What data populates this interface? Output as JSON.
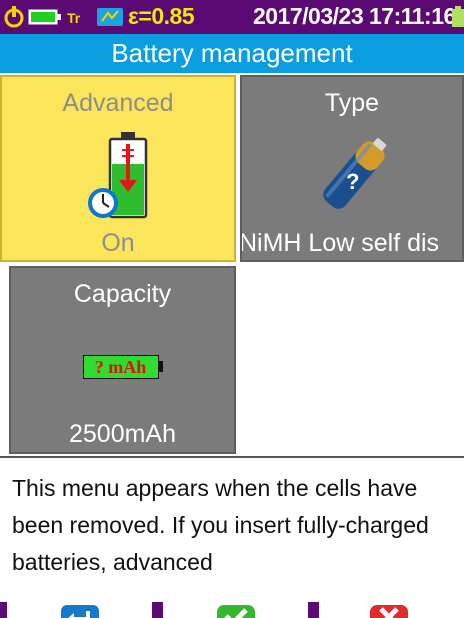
{
  "status_bar": {
    "emissivity_text": "ε=0.85",
    "datetime_text": "2017/03/23 17:11:16",
    "icons": [
      "power-icon",
      "battery-level-icon",
      "trigger-icon",
      "sd-card-icon",
      "battery-small-icon"
    ],
    "colors": {
      "background": "#5a0a72",
      "emissivity": "#f2ea00",
      "datetime": "#ffffff"
    }
  },
  "title": "Battery management",
  "tiles": {
    "advanced": {
      "label": "Advanced",
      "value": "On",
      "icon": "battery-charge-timer-icon",
      "active": true
    },
    "type": {
      "label": "Type",
      "value": "NiMH Low self dis",
      "icon": "battery-question-icon",
      "active": false
    },
    "capacity": {
      "label": "Capacity",
      "value": "2500mAh",
      "icon": "battery-capacity-icon",
      "icon_text": "? mAh",
      "active": false
    }
  },
  "description": "This menu appears when the cells have been removed. If you insert fully-charged batteries, advanced",
  "nav": {
    "buttons": [
      {
        "name": "enter",
        "icon": "enter-icon"
      },
      {
        "name": "confirm",
        "icon": "check-icon"
      },
      {
        "name": "cancel",
        "icon": "close-icon"
      }
    ]
  },
  "colors": {
    "accent": "#0a9ee0",
    "selected_tile": "#fbe65b",
    "tile": "#7b7b7b"
  }
}
